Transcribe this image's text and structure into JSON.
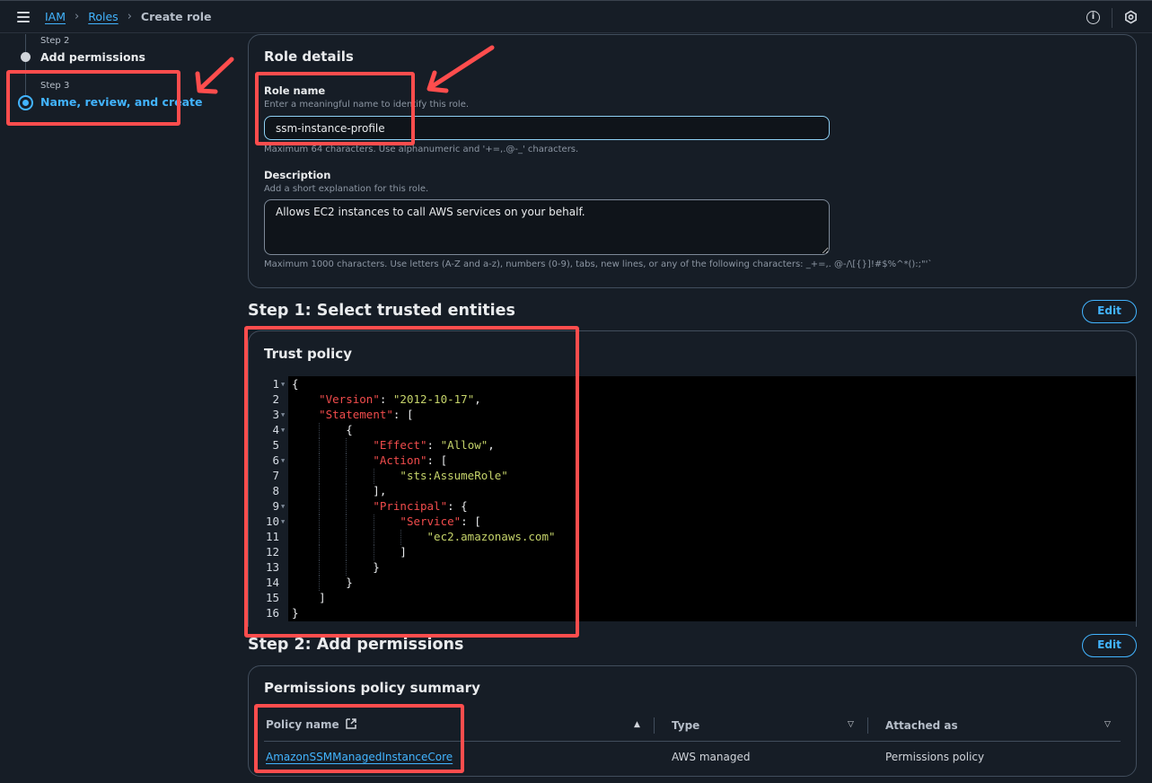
{
  "topbar": {
    "breadcrumb": [
      {
        "label": "IAM",
        "link": true
      },
      {
        "label": "Roles",
        "link": true
      },
      {
        "label": "Create role",
        "link": false
      }
    ],
    "icons": [
      "menu-icon",
      "info-icon",
      "settings-icon"
    ]
  },
  "nav": {
    "steps": [
      {
        "step": "Step 2",
        "title": "Add permissions",
        "active": false
      },
      {
        "step": "Step 3",
        "title": "Name, review, and create",
        "active": true
      }
    ]
  },
  "role_details": {
    "title": "Role details",
    "role_name": {
      "label": "Role name",
      "description": "Enter a meaningful name to identify this role.",
      "value": "ssm-instance-profile",
      "constraint": "Maximum 64 characters. Use alphanumeric and '+=,.@-_' characters."
    },
    "description": {
      "label": "Description",
      "description": "Add a short explanation for this role.",
      "value": "Allows EC2 instances to call AWS services on your behalf.",
      "constraint": "Maximum 1000 characters. Use letters (A-Z and a-z), numbers (0-9), tabs, new lines, or any of the following characters: _+=,. @-/\\[{}]!#$%^*():;\"'`"
    }
  },
  "step1": {
    "title": "Step 1: Select trusted entities",
    "edit_label": "Edit",
    "trust_policy": {
      "title": "Trust policy",
      "lines": [
        "{",
        "    \"Version\": \"2012-10-17\",",
        "    \"Statement\": [",
        "        {",
        "            \"Effect\": \"Allow\",",
        "            \"Action\": [",
        "                \"sts:AssumeRole\"",
        "            ],",
        "            \"Principal\": {",
        "                \"Service\": [",
        "                    \"ec2.amazonaws.com\"",
        "                ]",
        "            }",
        "        }",
        "    ]",
        "}"
      ],
      "foldable_lines": [
        1,
        3,
        4,
        6,
        9,
        10
      ]
    }
  },
  "step2": {
    "title": "Step 2: Add permissions",
    "edit_label": "Edit",
    "summary_title": "Permissions policy summary",
    "columns": [
      "Policy name",
      "Type",
      "Attached as"
    ],
    "rows": [
      {
        "policy_name": "AmazonSSMManagedInstanceCore",
        "type": "AWS managed",
        "attached_as": "Permissions policy"
      }
    ]
  },
  "colors": {
    "background": "#161d26",
    "accent": "#42b4ff",
    "annotation": "#ff4d4d",
    "json_key": "#f14c4c",
    "json_string": "#c5d36a"
  }
}
